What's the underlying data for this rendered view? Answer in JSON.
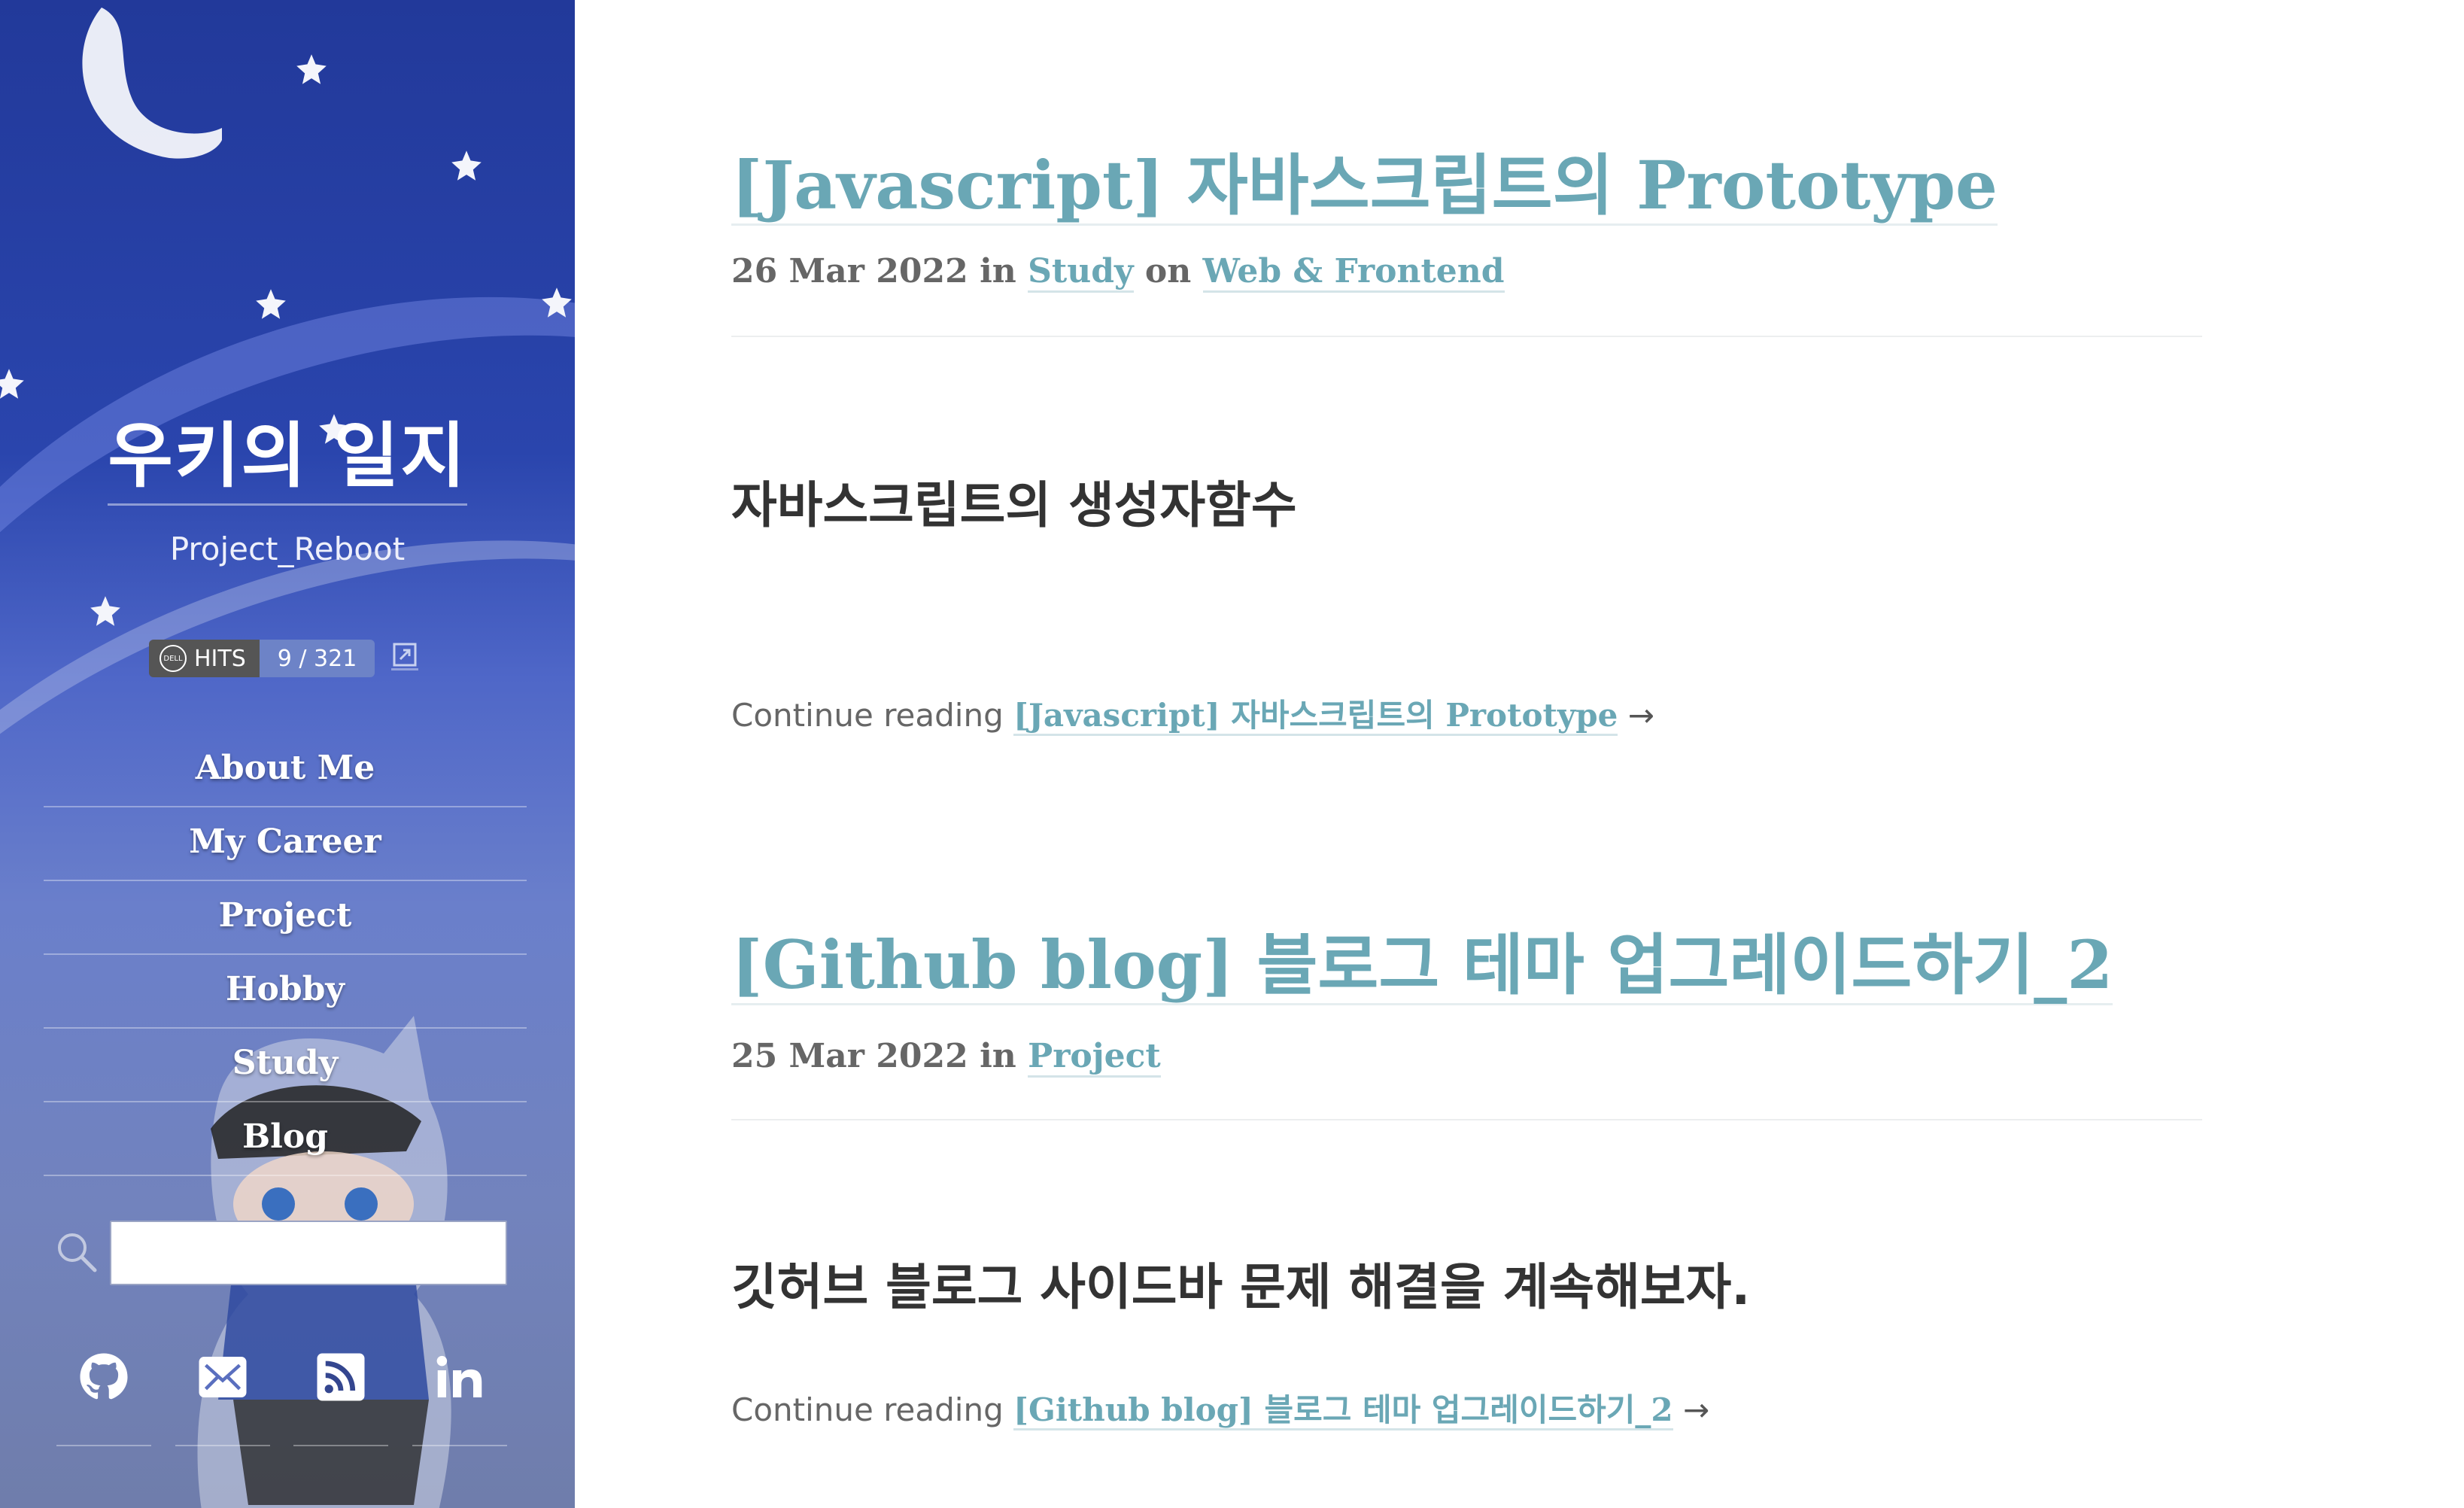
{
  "sidebar": {
    "title": "우키의 일지",
    "subtitle": "Project_Reboot",
    "hits": {
      "label": "HITS",
      "count": "9 / 321"
    },
    "menu": [
      "About Me",
      "My Career",
      "Project",
      "Hobby",
      "Study",
      "Blog"
    ],
    "search": {
      "placeholder": "",
      "value": ""
    },
    "social": [
      "github-icon",
      "email-icon",
      "rss-icon",
      "linkedin-icon"
    ]
  },
  "posts": [
    {
      "title": "[Javascript] 자바스크립트의 Prototype",
      "date": "26 Mar 2022",
      "in_word": "in",
      "category": "Study",
      "on_word": "on",
      "tag": "Web & Frontend",
      "excerpt": "자바스크립트의 생성자함수",
      "continue_label": "Continue reading",
      "continue_link": "[Javascript] 자바스크립트의 Prototype",
      "arrow": "→"
    },
    {
      "title": "[Github blog] 블로그 테마 업그레이드하기_2",
      "date": "25 Mar 2022",
      "in_word": "in",
      "category": "Project",
      "excerpt": "깃허브 블로그 사이드바 문제 해결을 계속해보자.",
      "continue_label": "Continue reading",
      "continue_link": "[Github blog] 블로그 테마 업그레이드하기_2",
      "arrow": "→"
    }
  ],
  "colors": {
    "link": "#6aa7b5",
    "sidebar_top": "#22399a",
    "sidebar_bottom": "#6f7dab"
  }
}
